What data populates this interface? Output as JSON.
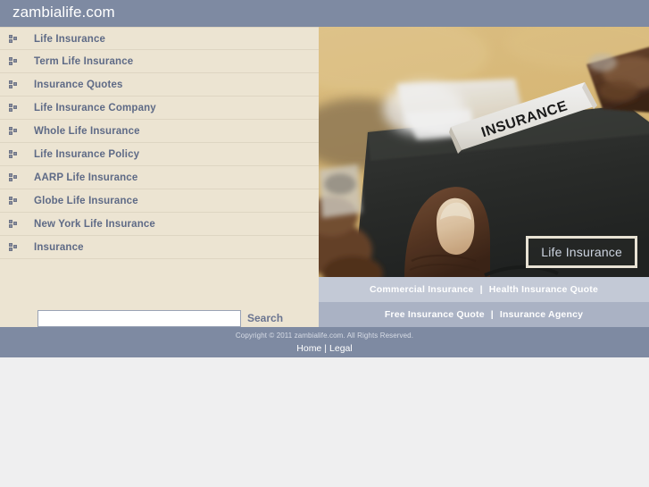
{
  "header": {
    "site_title": "zambialife.com",
    "bg_color": "#7e8aa2"
  },
  "sidebar": {
    "bg_color": "#ece4d2",
    "link_color": "#5e6a86",
    "bullet_icon": "bullet-square-icon",
    "items": [
      {
        "label": "Life Insurance"
      },
      {
        "label": "Term Life Insurance"
      },
      {
        "label": "Insurance Quotes"
      },
      {
        "label": "Life Insurance Company"
      },
      {
        "label": "Whole Life Insurance"
      },
      {
        "label": "Life Insurance Policy"
      },
      {
        "label": "AARP Life Insurance"
      },
      {
        "label": "Globe Life Insurance"
      },
      {
        "label": "New York Life Insurance"
      },
      {
        "label": "Insurance"
      }
    ]
  },
  "search": {
    "value": "",
    "placeholder": "",
    "button_label": "Search"
  },
  "hero": {
    "caption": "Life Insurance",
    "folder_tab_label": "INSURANCE",
    "alt": "Hand holding a dark document folder with a white INSURANCE label tab"
  },
  "link_strips": [
    {
      "bg_color": "#c3c9d6",
      "links": [
        {
          "label": "Commercial Insurance"
        },
        {
          "label": "Health Insurance Quote"
        }
      ],
      "separator": "|"
    },
    {
      "bg_color": "#aab2c4",
      "links": [
        {
          "label": "Free Insurance Quote"
        },
        {
          "label": "Insurance Agency"
        }
      ],
      "separator": "|"
    }
  ],
  "footer": {
    "bg_color": "#7e8aa2",
    "copyright": "Copyright © 2011 zambialife.com. All Rights Reserved.",
    "links": [
      {
        "label": "Home"
      },
      {
        "label": "Legal"
      }
    ],
    "separator": "|"
  }
}
